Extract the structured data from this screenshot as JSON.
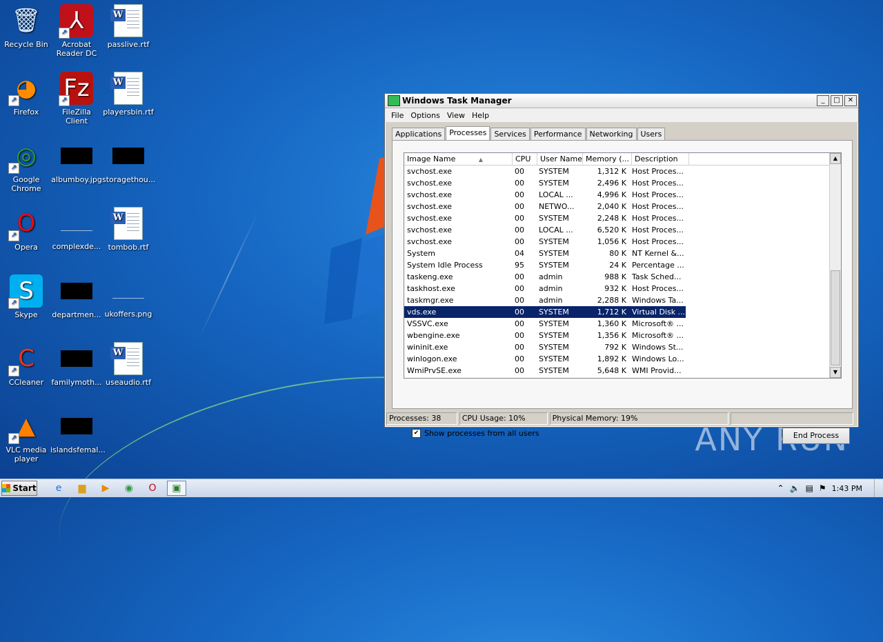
{
  "desktop": {
    "icons": [
      {
        "label": "Recycle Bin",
        "icon": "recycle-bin-icon"
      },
      {
        "label": "Acrobat Reader DC",
        "icon": "acrobat-icon"
      },
      {
        "label": "passlive.rtf",
        "icon": "word-doc-icon"
      },
      {
        "label": "Firefox",
        "icon": "firefox-icon"
      },
      {
        "label": "FileZilla Client",
        "icon": "filezilla-icon"
      },
      {
        "label": "playersbin.rtf",
        "icon": "word-doc-icon"
      },
      {
        "label": "Google Chrome",
        "icon": "chrome-icon"
      },
      {
        "label": "albumboy.jpg",
        "icon": "image-thumb-icon"
      },
      {
        "label": "storagethou...",
        "icon": "image-thumb-icon"
      },
      {
        "label": "Opera",
        "icon": "opera-icon"
      },
      {
        "label": "complexde...",
        "icon": "image-thumb-icon"
      },
      {
        "label": "tombob.rtf",
        "icon": "word-doc-icon"
      },
      {
        "label": "Skype",
        "icon": "skype-icon"
      },
      {
        "label": "departmen...",
        "icon": "image-thumb-icon"
      },
      {
        "label": "ukoffers.png",
        "icon": "image-thumb-icon"
      },
      {
        "label": "CCleaner",
        "icon": "ccleaner-icon"
      },
      {
        "label": "familymoth...",
        "icon": "image-thumb-icon"
      },
      {
        "label": "useaudio.rtf",
        "icon": "word-doc-icon"
      },
      {
        "label": "VLC media player",
        "icon": "vlc-icon"
      },
      {
        "label": "islandsfemal...",
        "icon": "image-thumb-icon"
      }
    ],
    "watermark": "ANY RUN"
  },
  "taskmgr": {
    "title": "Windows Task Manager",
    "menu": [
      "File",
      "Options",
      "View",
      "Help"
    ],
    "tabs": [
      "Applications",
      "Processes",
      "Services",
      "Performance",
      "Networking",
      "Users"
    ],
    "active_tab": "Processes",
    "columns": [
      "Image Name",
      "CPU",
      "User Name",
      "Memory (...",
      "Description"
    ],
    "sort_indicator": "▲",
    "rows": [
      {
        "name": "svchost.exe",
        "cpu": "00",
        "user": "SYSTEM",
        "mem": "1,312 K",
        "desc": "Host Proces..."
      },
      {
        "name": "svchost.exe",
        "cpu": "00",
        "user": "SYSTEM",
        "mem": "2,496 K",
        "desc": "Host Proces..."
      },
      {
        "name": "svchost.exe",
        "cpu": "00",
        "user": "LOCAL ...",
        "mem": "4,996 K",
        "desc": "Host Proces..."
      },
      {
        "name": "svchost.exe",
        "cpu": "00",
        "user": "NETWO...",
        "mem": "2,040 K",
        "desc": "Host Proces..."
      },
      {
        "name": "svchost.exe",
        "cpu": "00",
        "user": "SYSTEM",
        "mem": "2,248 K",
        "desc": "Host Proces..."
      },
      {
        "name": "svchost.exe",
        "cpu": "00",
        "user": "LOCAL ...",
        "mem": "6,520 K",
        "desc": "Host Proces..."
      },
      {
        "name": "svchost.exe",
        "cpu": "00",
        "user": "SYSTEM",
        "mem": "1,056 K",
        "desc": "Host Proces..."
      },
      {
        "name": "System",
        "cpu": "04",
        "user": "SYSTEM",
        "mem": "80 K",
        "desc": "NT Kernel &..."
      },
      {
        "name": "System Idle Process",
        "cpu": "95",
        "user": "SYSTEM",
        "mem": "24 K",
        "desc": "Percentage ..."
      },
      {
        "name": "taskeng.exe",
        "cpu": "00",
        "user": "admin",
        "mem": "988 K",
        "desc": "Task Sched..."
      },
      {
        "name": "taskhost.exe",
        "cpu": "00",
        "user": "admin",
        "mem": "932 K",
        "desc": "Host Proces..."
      },
      {
        "name": "taskmgr.exe",
        "cpu": "00",
        "user": "admin",
        "mem": "2,288 K",
        "desc": "Windows Ta..."
      },
      {
        "name": "vds.exe",
        "cpu": "00",
        "user": "SYSTEM",
        "mem": "1,712 K",
        "desc": "Virtual Disk ..."
      },
      {
        "name": "VSSVC.exe",
        "cpu": "00",
        "user": "SYSTEM",
        "mem": "1,360 K",
        "desc": "Microsoft® ..."
      },
      {
        "name": "wbengine.exe",
        "cpu": "00",
        "user": "SYSTEM",
        "mem": "1,356 K",
        "desc": "Microsoft® ..."
      },
      {
        "name": "wininit.exe",
        "cpu": "00",
        "user": "SYSTEM",
        "mem": "792 K",
        "desc": "Windows St..."
      },
      {
        "name": "winlogon.exe",
        "cpu": "00",
        "user": "SYSTEM",
        "mem": "1,892 K",
        "desc": "Windows Lo..."
      },
      {
        "name": "WmiPrvSE.exe",
        "cpu": "00",
        "user": "SYSTEM",
        "mem": "5,648 K",
        "desc": "WMI Provid..."
      }
    ],
    "selected_row": 12,
    "show_all_label": "Show processes from all users",
    "show_all_checked": true,
    "end_process_label": "End Process",
    "status": {
      "processes": "Processes: 38",
      "cpu": "CPU Usage: 10%",
      "memory": "Physical Memory: 19%"
    }
  },
  "taskbar": {
    "start_label": "Start",
    "apps": [
      "ie-icon",
      "explorer-icon",
      "media-player-icon",
      "chrome-icon",
      "opera-icon",
      "task-manager-icon"
    ],
    "clock": "1:43 PM"
  }
}
